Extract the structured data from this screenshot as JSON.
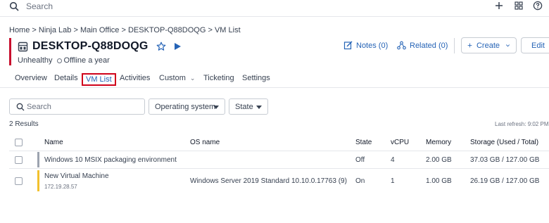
{
  "topbar": {
    "search_placeholder": "Search"
  },
  "breadcrumb": [
    "Home",
    "Ninja Lab",
    "Main Office",
    "DESKTOP-Q88DOQG",
    "VM List"
  ],
  "breadcrumb_separator": ">",
  "device": {
    "title": "DESKTOP-Q88DOQG",
    "health": "Unhealthy",
    "status": "Offline a year"
  },
  "header_actions": {
    "notes": "Notes (0)",
    "related": "Related (0)",
    "create": "Create",
    "edit": "Edit"
  },
  "tabs": [
    "Overview",
    "Details",
    "VM List",
    "Activities",
    "Custom",
    "Ticketing",
    "Settings"
  ],
  "active_tab": "VM List",
  "filters": {
    "search_placeholder": "Search",
    "os_dropdown": "Operating system",
    "state_dropdown": "State"
  },
  "results_count": "2 Results",
  "last_refresh": "Last refresh: 9:02 PM",
  "table": {
    "columns": [
      "Name",
      "OS name",
      "State",
      "vCPU",
      "Memory",
      "Storage (Used / Total)"
    ],
    "rows": [
      {
        "name": "Windows 10 MSIX packaging environment",
        "ip": "",
        "os": "",
        "state": "Off",
        "vcpu": "4",
        "memory": "2.00 GB",
        "storage": "37.03 GB / 127.00 GB",
        "status_color": "#9ca3af"
      },
      {
        "name": "New Virtual Machine",
        "ip": "172.19.28.57",
        "os": "Windows Server 2019 Standard 10.10.0.17763 (9)",
        "state": "On",
        "vcpu": "1",
        "memory": "1.00 GB",
        "storage": "26.19 GB / 127.00 GB",
        "status_color": "#f2c12e"
      }
    ]
  },
  "colors": {
    "accent": "#c8102e",
    "link": "#2563b6",
    "tab_highlight": "#d0021b"
  },
  "icons": [
    "search-icon",
    "plus-icon",
    "grid-icon",
    "help-icon",
    "device-icon",
    "star-icon",
    "play-icon",
    "notes-icon",
    "related-icon",
    "edit-icon",
    "chevron-down-icon"
  ]
}
